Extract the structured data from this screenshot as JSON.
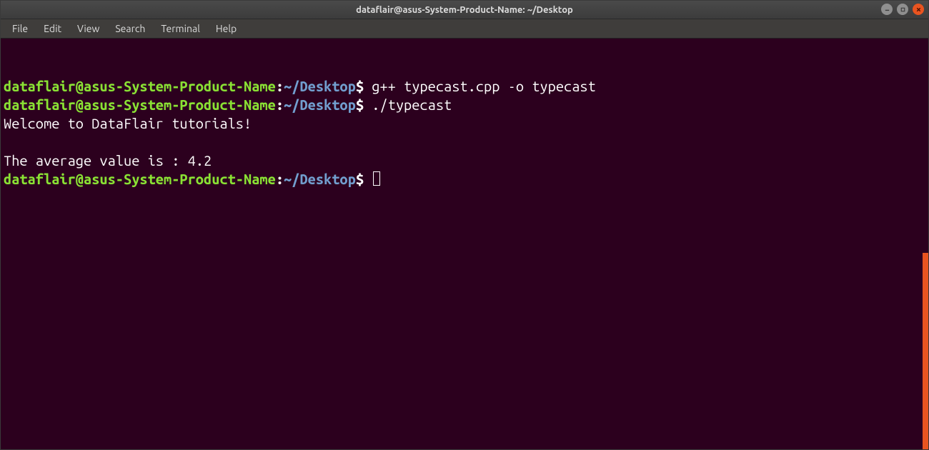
{
  "window": {
    "title": "dataflair@asus-System-Product-Name: ~/Desktop"
  },
  "menubar": {
    "items": [
      "File",
      "Edit",
      "View",
      "Search",
      "Terminal",
      "Help"
    ]
  },
  "terminal": {
    "lines": [
      {
        "type": "prompt",
        "user": "dataflair@asus-System-Product-Name",
        "colon": ":",
        "path": "~/Desktop",
        "dollar": "$",
        "command": " g++ typecast.cpp -o typecast"
      },
      {
        "type": "prompt",
        "user": "dataflair@asus-System-Product-Name",
        "colon": ":",
        "path": "~/Desktop",
        "dollar": "$",
        "command": " ./typecast"
      },
      {
        "type": "output",
        "text": "Welcome to DataFlair tutorials!"
      },
      {
        "type": "output",
        "text": ""
      },
      {
        "type": "output",
        "text": "The average value is : 4.2"
      },
      {
        "type": "prompt",
        "user": "dataflair@asus-System-Product-Name",
        "colon": ":",
        "path": "~/Desktop",
        "dollar": "$",
        "command": " ",
        "cursor": true
      }
    ]
  }
}
